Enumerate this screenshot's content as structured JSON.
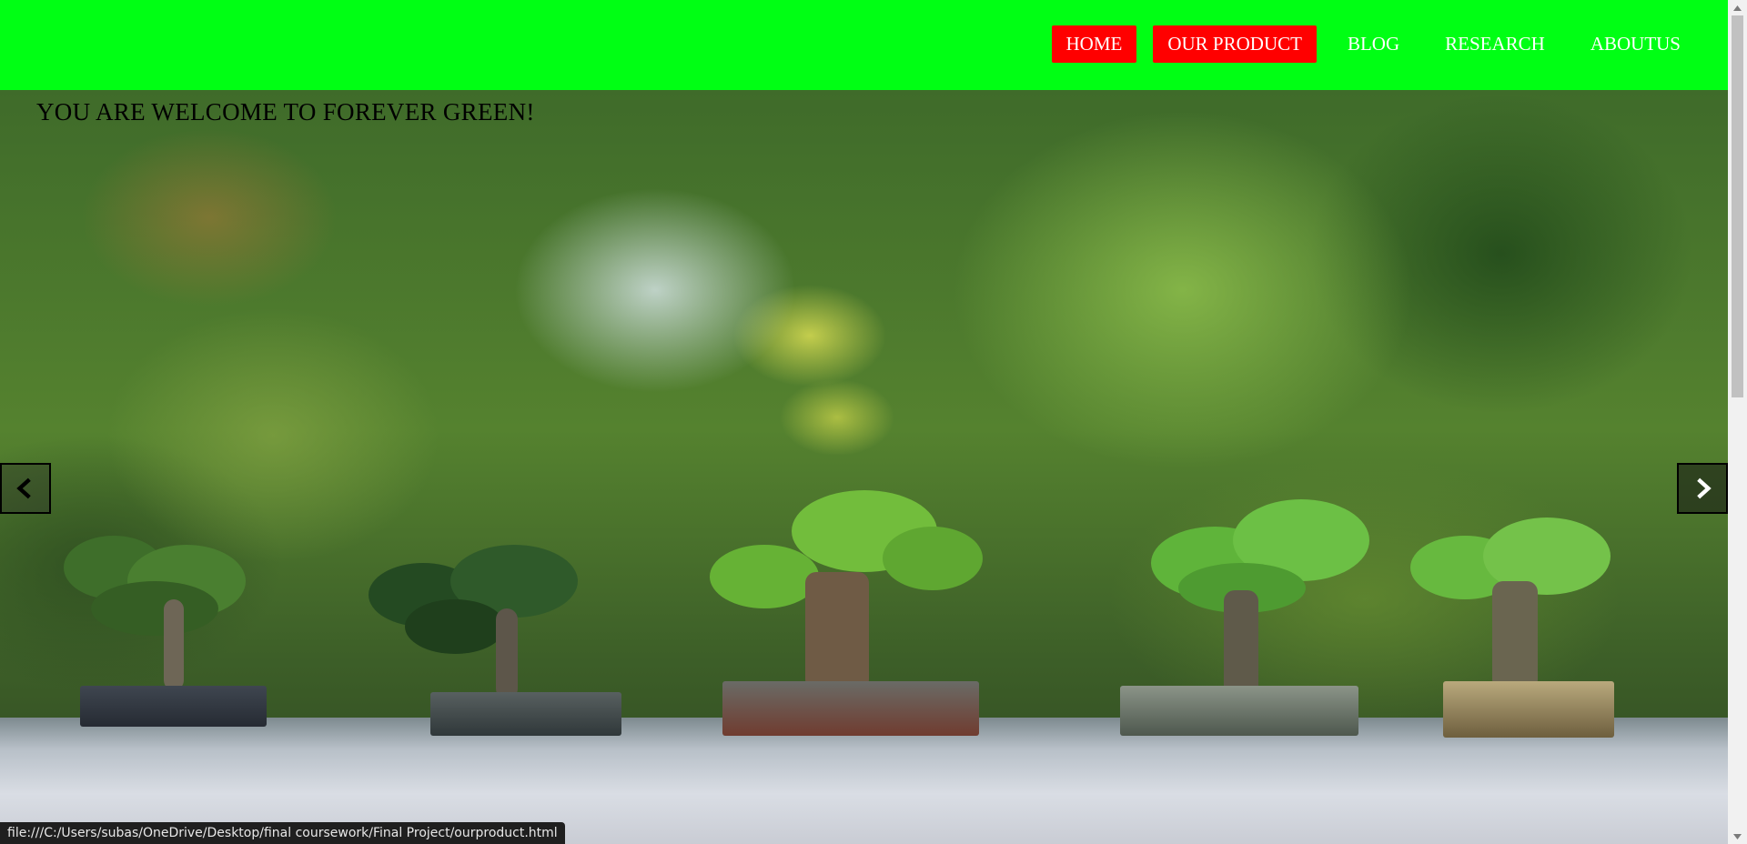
{
  "nav": {
    "items": [
      {
        "label": "HOME",
        "active": true
      },
      {
        "label": "OUR PRODUCT",
        "active": true
      },
      {
        "label": "BLOG",
        "active": false
      },
      {
        "label": "RESEARCH",
        "active": false
      },
      {
        "label": "ABOUTUS",
        "active": false
      }
    ]
  },
  "hero": {
    "welcome": "YOU ARE WELCOME TO FOREVER GREEN!"
  },
  "carousel": {
    "prev_icon": "chevron-left-icon",
    "next_icon": "chevron-right-icon"
  },
  "status_bar": {
    "url": "file:///C:/Users/subas/OneDrive/Desktop/final coursework/Final Project/ourproduct.html"
  },
  "colors": {
    "navbar_bg": "#00ff14",
    "active_nav_bg": "#ff0000",
    "nav_text": "#ffffff"
  }
}
